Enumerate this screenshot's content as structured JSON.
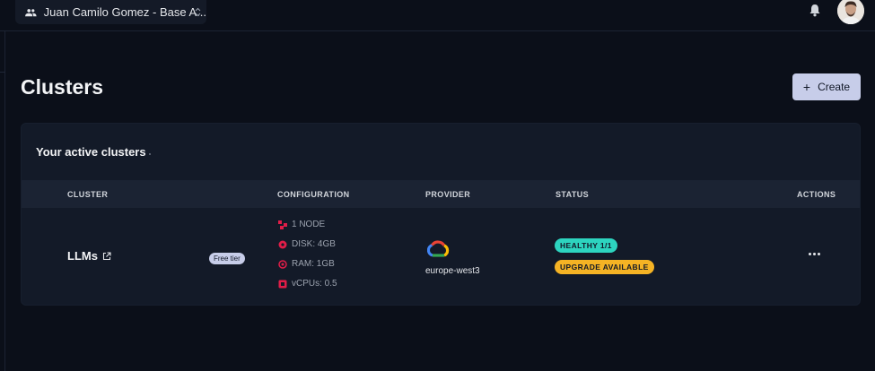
{
  "header": {
    "org_label": "Juan Camilo Gomez - Base A...",
    "icons": [
      "people-icon",
      "updown-icon",
      "bell-icon",
      "avatar"
    ]
  },
  "page": {
    "title": "Clusters",
    "create_label": "Create"
  },
  "card": {
    "title": "Your active clusters"
  },
  "table": {
    "headers": {
      "cluster": "CLUSTER",
      "configuration": "CONFIGURATION",
      "provider": "PROVIDER",
      "status": "STATUS",
      "actions": "ACTIONS"
    },
    "rows": [
      {
        "name": "LLMs",
        "tier": "Free tier",
        "config": {
          "nodes": "1 NODE",
          "disk": "DISK: 4GB",
          "ram": "RAM: 1GB",
          "vcpus": "vCPUs: 0.5"
        },
        "provider_icon": "google-cloud-icon",
        "region": "europe-west3",
        "status": {
          "health": "HEALTHY 1/1",
          "upgrade": "UPGRADE AVAILABLE"
        }
      }
    ]
  },
  "colors": {
    "background": "#0b0f19",
    "card": "#131a28",
    "table_header": "#1b2333",
    "accent_button": "#c7cde9",
    "healthy": "#2dd4bf",
    "upgrade": "#f5b324",
    "config_icon": "#e11d48"
  }
}
